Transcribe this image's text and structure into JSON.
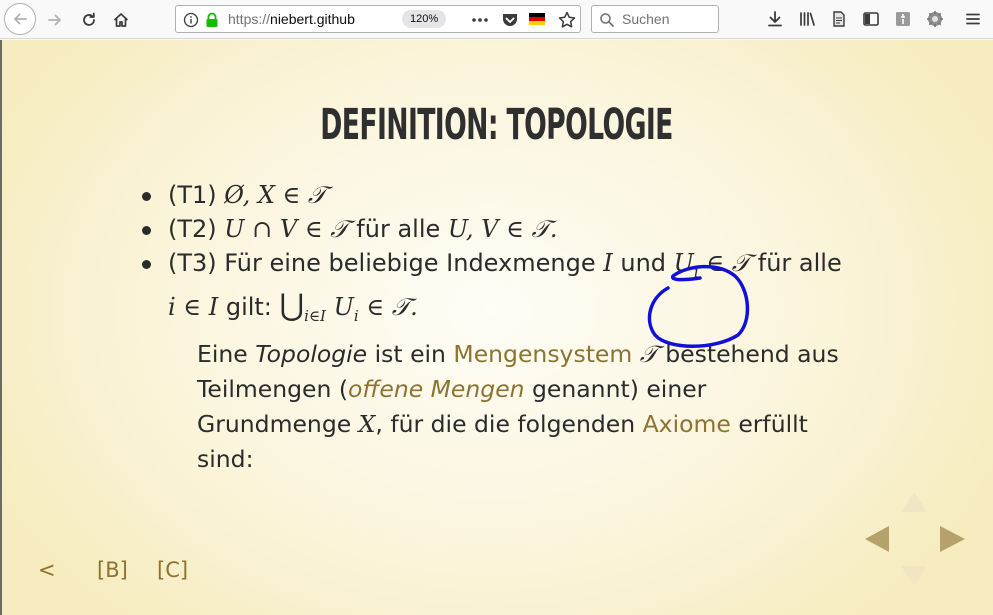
{
  "browser": {
    "url": {
      "scheme": "https://",
      "host": "niebert.github"
    },
    "zoom": "120%",
    "search_placeholder": "Suchen",
    "icons": [
      "back-icon",
      "forward-icon",
      "reload-icon",
      "home-icon",
      "info-icon",
      "lock-icon",
      "page-actions-icon",
      "pocket-icon",
      "german-flag-icon",
      "bookmark-star-icon",
      "download-icon",
      "library-icon",
      "reader-icon",
      "sidebar-icon",
      "extension-icon",
      "addon-gear-icon",
      "menu-icon"
    ]
  },
  "slide": {
    "title": "DEFINITION: TOPOLOGIE",
    "axioms": {
      "t1_label": "(T1)",
      "t1_math": "Ø, X ∈ 𝒯",
      "t2_label": "(T2)",
      "t2_math": "U ∩ V ∈ 𝒯",
      "t2_text": "für alle",
      "t2_math2": "U, V ∈ 𝒯.",
      "t3_label": "(T3) Für eine beliebige Indexmenge",
      "t3_I": "I",
      "t3_und": "und",
      "t3_Ui": "U",
      "t3_i": "i",
      "t3_inT": "∈ 𝒯",
      "t3_fueralle": "für alle",
      "t3_line2_a": "i ∈ I",
      "t3_gilt": "gilt:",
      "t3_union": "⋃",
      "t3_union_sub": "i∈I",
      "t3_Ui2": "U",
      "t3_i2": "i",
      "t3_end": "∈ 𝒯."
    },
    "definition": {
      "p1": "Eine ",
      "topologie": "Topologie",
      "p2": " ist ein ",
      "mengensystem": "Mengensystem",
      "T": " 𝒯",
      "p3": " bestehend aus Teilmengen (",
      "offene": "offene Mengen",
      "p4": " genannt) einer Grundmenge ",
      "X": "X",
      "p5": ", für die die folgenden ",
      "axiome": "Axiome",
      "p6": " erfüllt sind:"
    },
    "nav": {
      "prev": "<",
      "b": "[B]",
      "c": "[C]"
    },
    "colors": {
      "highlight": "#8b7331",
      "annotation": "#1010d8",
      "controls": "#b5a16a"
    }
  }
}
